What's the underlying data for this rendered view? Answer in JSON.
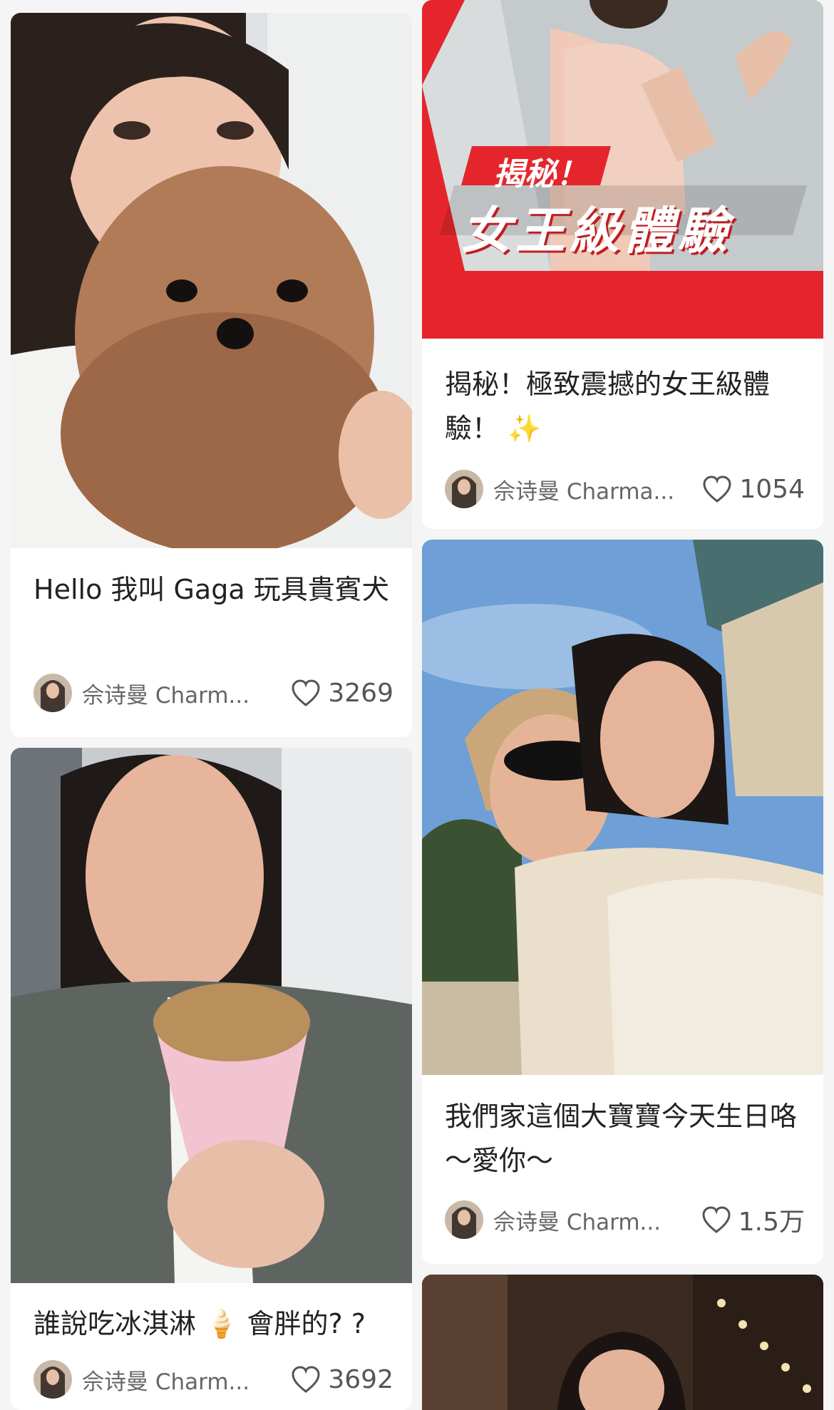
{
  "feed": [
    {
      "title": "Hello 我叫 Gaga 玩具貴賓犬",
      "author": "佘诗曼 Charm...",
      "likes": "3269",
      "photo_description": "woman with toy poodle"
    },
    {
      "title": "揭秘！極致震撼的女王級體驗！ ✨",
      "author": "佘诗曼 Charma...",
      "likes": "1054",
      "banner_small": "揭秘！",
      "banner_big": "女王級體驗"
    },
    {
      "title": "誰說吃冰淇淋 🍦 會胖的? ?",
      "author": "佘诗曼 Charm...",
      "likes": "3692"
    },
    {
      "title": "我們家這個大寶寶今天生日咯～愛你～",
      "author": "佘诗曼 Charm...",
      "likes": "1.5万"
    }
  ],
  "colors": {
    "brand_red": "#e4262c",
    "like_icon": "#555555"
  }
}
